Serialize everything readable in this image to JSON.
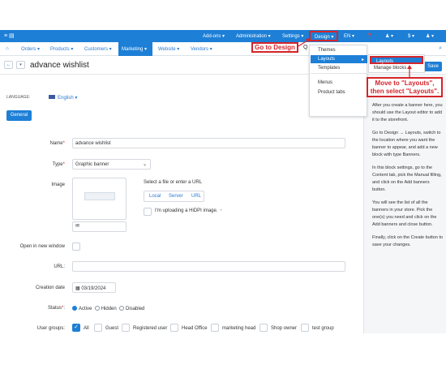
{
  "topbar": {
    "left_icons": "≡ ▤",
    "items": [
      "Add-ons ▾",
      "Administration ▾",
      "Settings ▾",
      "Design ▾",
      "EN ▾"
    ],
    "right_icons": [
      "❓",
      "♟ ▾",
      "$ ▾",
      "♟ ▾"
    ]
  },
  "nav": {
    "home": "⌂",
    "items": [
      "Orders ▾",
      "Products ▾",
      "Customers ▾",
      "Marketing ▾",
      "Website ▾",
      "Vendors ▾"
    ],
    "search": "⌕"
  },
  "title": {
    "back": "←",
    "dropdown": "▾",
    "text": "advance wishlist"
  },
  "save_label": "Save",
  "design_menu": {
    "items": [
      "Themes",
      "Layouts",
      "Templates",
      "Menus",
      "Product tabs"
    ]
  },
  "layouts_submenu": {
    "items": [
      "Layouts",
      "Manage blocks"
    ]
  },
  "callouts": {
    "design": "Go to Design",
    "layouts": "Move to \"Layouts\", then select \"Layouts\"."
  },
  "language": {
    "label": "LANGUAGE:",
    "value": "English ▾",
    "flag_color": "#3c5aa0"
  },
  "tabs": {
    "general": "General"
  },
  "form": {
    "name_label": "Name",
    "name_value": "advance wishlist",
    "type_label": "Type",
    "type_value": "Graphic banner",
    "image_label": "Image",
    "file_text": "Select a file or enter a URL",
    "file_tabs": [
      "Local",
      "Server",
      "URL"
    ],
    "hidpi_label": "I'm uploading a HiDPI image.",
    "new_window_label": "Open in new window",
    "url_label": "URL:",
    "creation_label": "Creation date",
    "creation_value": "03/19/2024",
    "status_label": "Status",
    "status_options": [
      "Active",
      "Hidden",
      "Disabled"
    ],
    "status_selected": "Active",
    "usergroups_label": "User groups:",
    "usergroups": [
      "All",
      "Guest",
      "Registered user",
      "Head Office",
      "marketing head",
      "Shop owner",
      "test group"
    ]
  },
  "help": {
    "p1": "After you create a banner here, you should use the Layout editor to add it to the storefront.",
    "p2": "Go to Design → Layouts, switch to the location where you want the banner to appear, and add a new block with type Banners.",
    "p3": "In this block settings, go to the Content tab, pick the Manual filling, and click on the Add banners button.",
    "p4": "You will see the list of all the banners in your store. Pick the one(s) you need and click on the Add banners and close button.",
    "p5": "Finally, click on the Create button to save your changes."
  },
  "colors": {
    "primary": "#1d7fd6",
    "callout_red": "#d4252b"
  }
}
